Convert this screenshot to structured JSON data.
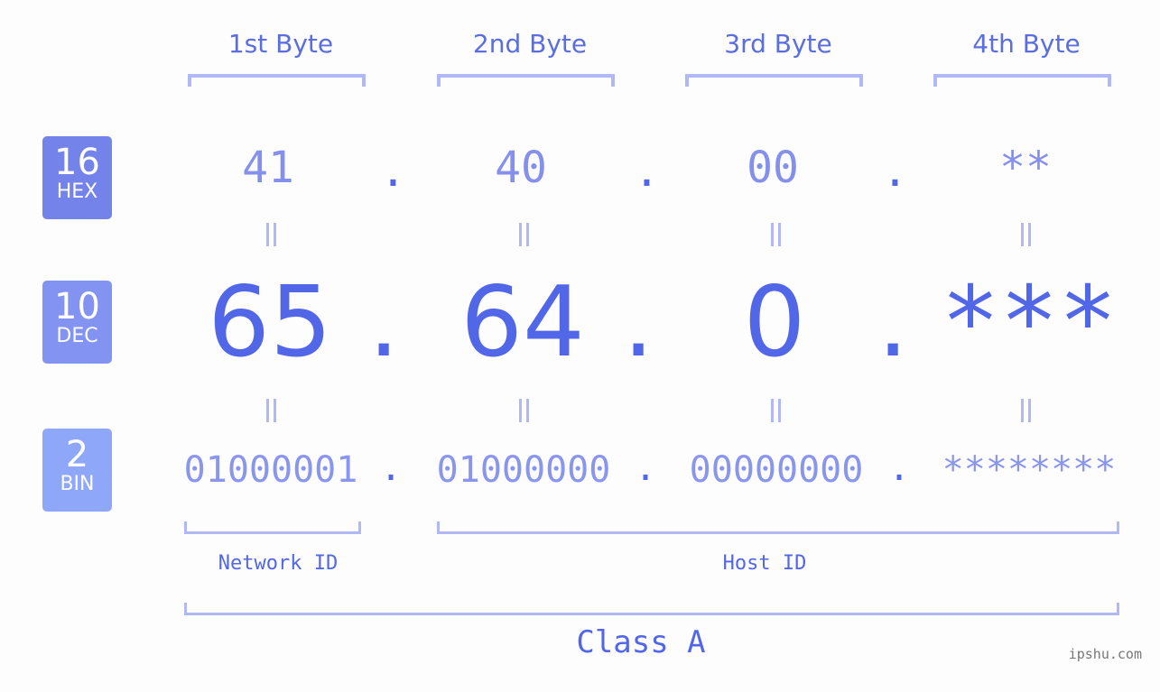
{
  "bases": [
    {
      "number": "16",
      "label": "HEX",
      "color": "#7383ea"
    },
    {
      "number": "10",
      "label": "DEC",
      "color": "#8393f2"
    },
    {
      "number": "2",
      "label": "BIN",
      "color": "#8fa7f8"
    }
  ],
  "byte_headers": [
    "1st Byte",
    "2nd Byte",
    "3rd Byte",
    "4th Byte"
  ],
  "hex": [
    "41",
    "40",
    "00",
    "**"
  ],
  "dec": [
    "65",
    "64",
    "0",
    "***"
  ],
  "bin": [
    "01000001",
    "01000000",
    "00000000",
    "********"
  ],
  "separator": ".",
  "network_label": "Network ID",
  "host_label": "Host ID",
  "class_label": "Class A",
  "watermark": "ipshu.com"
}
